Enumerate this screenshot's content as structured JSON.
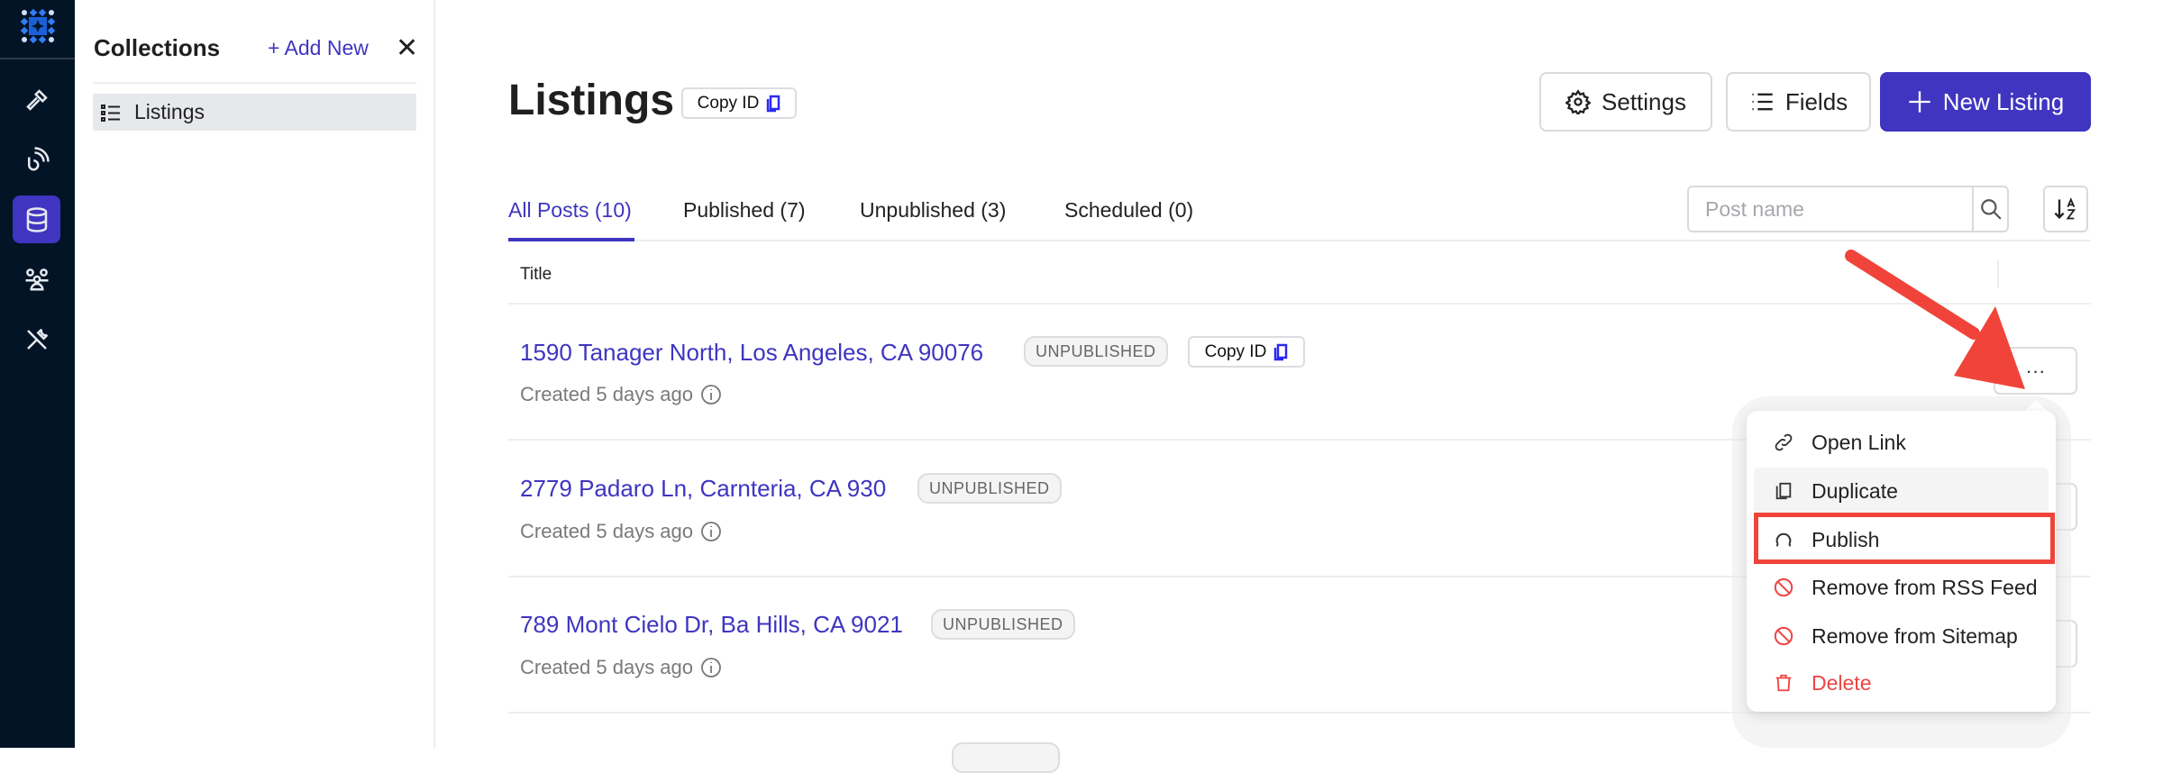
{
  "rail": {
    "items": [
      {
        "icon": "hammer-icon"
      },
      {
        "icon": "broadcast-icon"
      },
      {
        "icon": "database-icon",
        "active": true
      },
      {
        "icon": "users-icon"
      },
      {
        "icon": "tools-icon"
      }
    ]
  },
  "panel": {
    "title": "Collections",
    "add_label": "+ Add New",
    "close": "✕",
    "items": [
      {
        "label": "Listings",
        "icon": "list-icon"
      }
    ]
  },
  "header": {
    "title": "Listings",
    "copy_id": "Copy ID",
    "settings": "Settings",
    "fields": "Fields",
    "new": "New Listing"
  },
  "tabs": [
    {
      "label": "All Posts (10)",
      "active": true
    },
    {
      "label": "Published (7)"
    },
    {
      "label": "Unpublished (3)"
    },
    {
      "label": "Scheduled (0)"
    }
  ],
  "search": {
    "placeholder": "Post name"
  },
  "table": {
    "header": "Title",
    "rows": [
      {
        "title": "1590 Tanager North, Los Angeles, CA 90076",
        "status": "UNPUBLISHED",
        "copy_id": "Copy ID",
        "created": "Created 5 days ago"
      },
      {
        "title": "2779 Padaro Ln, Carnteria, CA 930",
        "status": "UNPUBLISHED",
        "created": "Created 5 days ago"
      },
      {
        "title": "789 Mont Cielo Dr, Ba Hills, CA 9021",
        "status": "UNPUBLISHED",
        "created": "Created 5 days ago"
      }
    ]
  },
  "more_label": "···",
  "menu": {
    "items": [
      {
        "label": "Open Link",
        "icon": "link-icon"
      },
      {
        "label": "Duplicate",
        "icon": "copy-icon",
        "hover": true
      },
      {
        "label": "Publish",
        "icon": "publish-icon",
        "highlighted": true
      },
      {
        "label": "Remove from RSS Feed",
        "icon": "ban-icon"
      },
      {
        "label": "Remove from Sitemap",
        "icon": "ban-icon"
      },
      {
        "label": "Delete",
        "icon": "trash-icon",
        "danger": true
      }
    ]
  },
  "colors": {
    "accent": "#3f35c0",
    "rail": "#021426",
    "danger": "#ef4444",
    "annotation": "#f0443a"
  }
}
